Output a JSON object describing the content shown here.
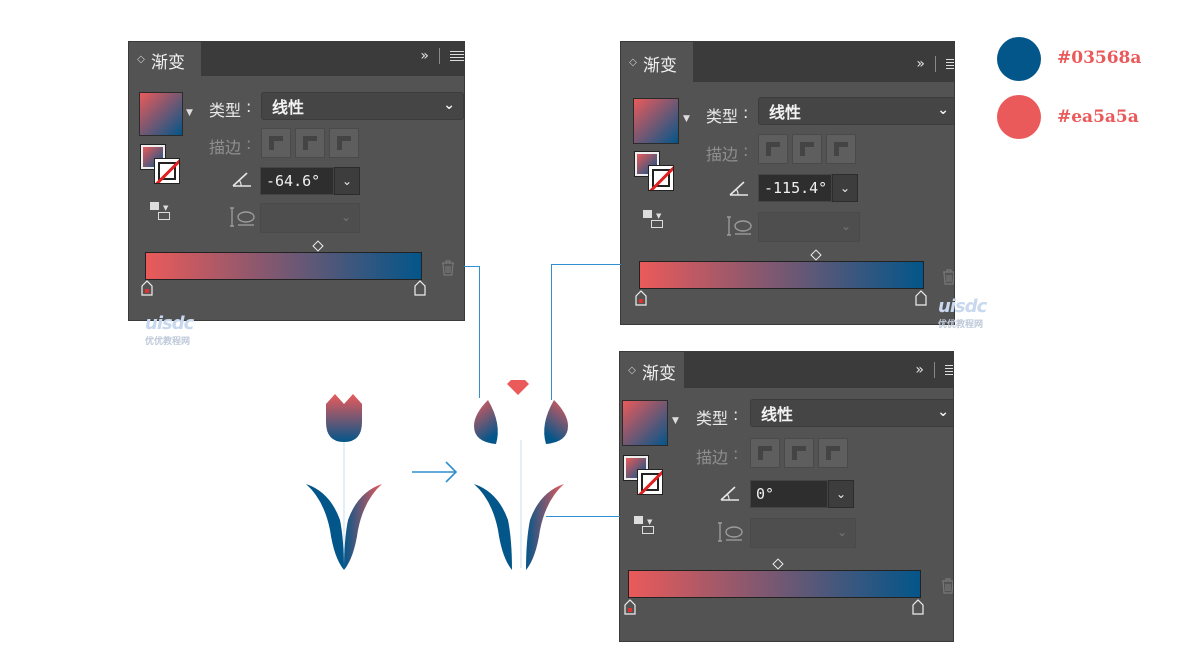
{
  "panels": [
    {
      "id": "panel1",
      "title": "渐变",
      "type_label": "类型",
      "type_value": "线性",
      "stroke_label": "描边",
      "angle_value": "-64.6°",
      "colors": {
        "start": "#ea5a5a",
        "end": "#03568a"
      }
    },
    {
      "id": "panel2",
      "title": "渐变",
      "type_label": "类型",
      "type_value": "线性",
      "stroke_label": "描边",
      "angle_value": "-115.4°",
      "colors": {
        "start": "#ea5a5a",
        "end": "#03568a"
      }
    },
    {
      "id": "panel3",
      "title": "渐变",
      "type_label": "类型",
      "type_value": "线性",
      "stroke_label": "描边",
      "angle_value": "0°",
      "colors": {
        "start": "#ea5a5a",
        "end": "#03568a"
      }
    }
  ],
  "legend": [
    {
      "hex": "#03568a",
      "label": "#03568a"
    },
    {
      "hex": "#ea5a5a",
      "label": "#ea5a5a"
    }
  ],
  "watermark": {
    "logo": "uisdc",
    "text": "优优教程网"
  },
  "icons": {
    "collapse": "double-chevron-right-icon",
    "menu": "hamburger-menu-icon",
    "angle": "angle-icon",
    "aspect": "aspect-ratio-icon",
    "delete": "trash-icon",
    "arrow": "right-arrow-icon"
  }
}
